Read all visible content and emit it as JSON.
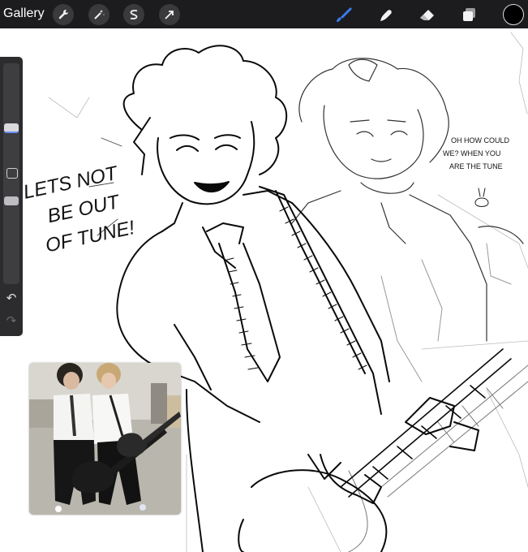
{
  "toolbar": {
    "gallery_label": "Gallery",
    "left_tools": [
      {
        "name": "actions",
        "icon": "wrench-icon"
      },
      {
        "name": "adjustments",
        "icon": "magic-wand-icon"
      },
      {
        "name": "selection",
        "icon": "selection-s-icon"
      },
      {
        "name": "transform",
        "icon": "arrow-cursor-icon"
      }
    ],
    "right_tools": [
      {
        "name": "brush",
        "icon": "brush-icon",
        "active": true
      },
      {
        "name": "smudge",
        "icon": "smudge-icon",
        "active": false
      },
      {
        "name": "eraser",
        "icon": "eraser-icon",
        "active": false
      },
      {
        "name": "layers",
        "icon": "layers-icon",
        "active": false
      }
    ],
    "current_color": "#000000",
    "accent_color": "#3a7cf5"
  },
  "sidebar": {
    "brush_size_level": 0.55,
    "opacity_level": 0.9,
    "undo_icon": "undo-icon",
    "redo_icon": "redo-icon"
  },
  "canvas": {
    "text_left": [
      "LETS NOT",
      "BE OUT",
      "OF TUNE!"
    ],
    "text_right": [
      "OH HOW COULD",
      "WE? WHEN YOU",
      "ARE THE TUNE"
    ]
  },
  "reference": {
    "description_icon": "reference-photo"
  }
}
